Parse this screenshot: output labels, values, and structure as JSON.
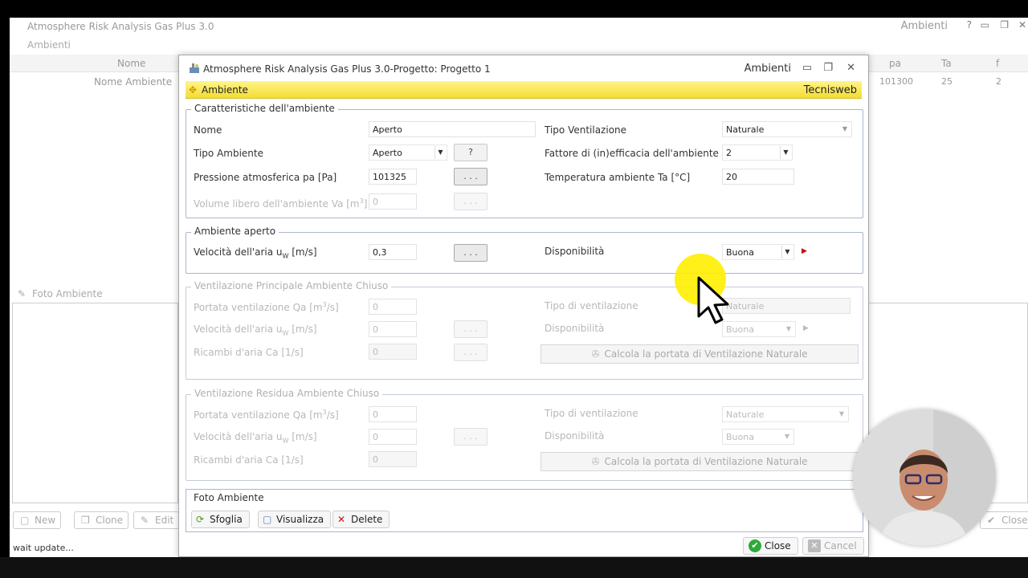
{
  "main": {
    "title": "Atmosphere Risk Analysis Gas Plus 3.0",
    "title_right": "Ambienti",
    "subtitle": "Ambienti",
    "grid_headers": {
      "nome": "Nome",
      "pa": "pa",
      "ta": "Ta",
      "f": "f"
    },
    "grid_row": {
      "nome": "Nome Ambiente",
      "pa": "101300",
      "ta": "25",
      "f": "2"
    },
    "foto_label": "Foto Ambiente",
    "buttons": {
      "new": "New",
      "clone": "Clone",
      "edit": "Edit",
      "close": "Close"
    },
    "status": "wait update..."
  },
  "dialog": {
    "title": "Atmosphere Risk Analysis Gas Plus 3.0-Progetto: Progetto 1",
    "title_right": "Ambienti",
    "bar_left": "Ambiente",
    "bar_right": "Tecnisweb",
    "caratteristiche": {
      "title": "Caratteristiche dell'ambiente",
      "nome_label": "Nome",
      "nome_value": "Aperto",
      "tipo_ambiente_label": "Tipo Ambiente",
      "tipo_ambiente_value": "Aperto",
      "help_label": "?",
      "pressione_label": "Pressione atmosferica pa [Pa]",
      "pressione_value": "101325",
      "dots": ". . .",
      "volume_label_pre": "Volume libero dell'ambiente Va [m",
      "volume_label_sup": "3",
      "volume_label_post": "]",
      "volume_value": "0",
      "tipo_ventilazione_label": "Tipo Ventilazione",
      "tipo_ventilazione_value": "Naturale",
      "fattore_label": "Fattore di (in)efficacia dell'ambiente fa",
      "fattore_value": "2",
      "temperatura_label": "Temperatura ambiente Ta [°C]",
      "temperatura_value": "20"
    },
    "aperto": {
      "title": "Ambiente aperto",
      "velocita_label_pre": "Velocità dell'aria u",
      "velocita_label_sub": "W",
      "velocita_label_post": " [m/s]",
      "velocita_value": "0,3",
      "dots": ". . .",
      "disponibilita_label": "Disponibilità",
      "disponibilita_value": "Buona"
    },
    "principale": {
      "title": "Ventilazione Principale Ambiente Chiuso",
      "portata_label_pre": "Portata ventilazione Qa [m",
      "portata_label_sup": "3",
      "portata_label_post": "/s]",
      "portata_value": "0",
      "velocita_label_pre": "Velocità dell'aria u",
      "velocita_label_sub": "W",
      "velocita_label_post": " [m/s]",
      "velocita_value": "0",
      "ricambi_label": "Ricambi d'aria Ca [1/s]",
      "ricambi_value": "0",
      "dots": ". . .",
      "tipo_label": "Tipo di ventilazione",
      "tipo_value": "Naturale",
      "disponibilita_label": "Disponibilità",
      "disponibilita_value": "Buona",
      "calcola_label": "Calcola la portata di Ventilazione Naturale"
    },
    "residua": {
      "title": "Ventilazione Residua Ambiente Chiuso",
      "portata_label_pre": "Portata ventilazione Qa [m",
      "portata_label_sup": "3",
      "portata_label_post": "/s]",
      "portata_value": "0",
      "velocita_label_pre": "Velocità dell'aria u",
      "velocita_label_sub": "W",
      "velocita_label_post": " [m/s]",
      "velocita_value": "0",
      "ricambi_label": "Ricambi d'aria Ca [1/s]",
      "ricambi_value": "0",
      "dots": ". . .",
      "tipo_label": "Tipo di ventilazione",
      "tipo_value": "Naturale",
      "disponibilita_label": "Disponibilità",
      "disponibilita_value": "Buona",
      "calcola_label": "Calcola la portata di Ventilazione Naturale"
    },
    "foto": {
      "title": "Foto Ambiente",
      "sfoglia": "Sfoglia",
      "visualizza": "Visualizza",
      "delete": "Delete"
    },
    "close_label": "Close",
    "cancel_label": "Cancel"
  }
}
